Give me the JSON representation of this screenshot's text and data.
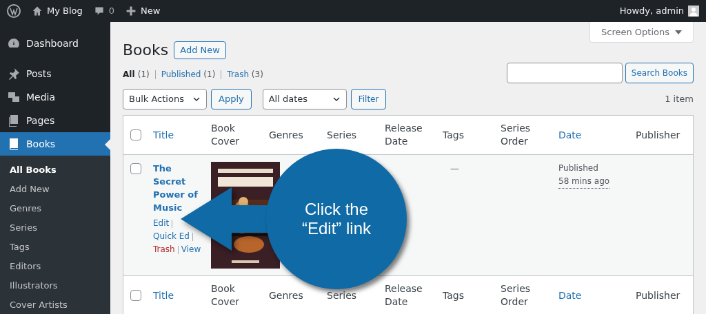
{
  "admin_bar": {
    "site": "My Blog",
    "comments": "0",
    "new": "New",
    "greeting": "Howdy, admin"
  },
  "sidebar": {
    "items": [
      {
        "label": "Dashboard",
        "selected": false
      },
      {
        "label": "Posts",
        "selected": false
      },
      {
        "label": "Media",
        "selected": false
      },
      {
        "label": "Pages",
        "selected": false
      },
      {
        "label": "Books",
        "selected": true,
        "children": [
          {
            "label": "All Books",
            "selected": true
          },
          {
            "label": "Add New",
            "selected": false
          },
          {
            "label": "Genres",
            "selected": false
          },
          {
            "label": "Series",
            "selected": false
          },
          {
            "label": "Tags",
            "selected": false
          },
          {
            "label": "Editors",
            "selected": false
          },
          {
            "label": "Illustrators",
            "selected": false
          },
          {
            "label": "Cover Artists",
            "selected": false
          }
        ]
      }
    ]
  },
  "screen_options": "Screen Options",
  "page_title": "Books",
  "add_new": "Add New",
  "filters": [
    {
      "label": "All",
      "count": "(1)",
      "selected": true
    },
    {
      "label": "Published",
      "count": "(1)",
      "selected": false
    },
    {
      "label": "Trash",
      "count": "(3)",
      "selected": false
    }
  ],
  "search": {
    "button": "Search Books"
  },
  "bulk_actions": "Bulk Actions",
  "apply": "Apply",
  "dates": "All dates",
  "filter": "Filter",
  "item_count": "1 item",
  "table": {
    "header_checked": false,
    "footer_checked": false,
    "columns": [
      {
        "label": "Title",
        "sortable": true
      },
      {
        "label": "Book Cover",
        "sortable": false
      },
      {
        "label": "Genres",
        "sortable": false
      },
      {
        "label": "Series",
        "sortable": false
      },
      {
        "label": "Release Date",
        "sortable": false
      },
      {
        "label": "Tags",
        "sortable": false
      },
      {
        "label": "Series Order",
        "sortable": false
      },
      {
        "label": "Date",
        "sortable": true
      },
      {
        "label": "Publisher",
        "sortable": false
      }
    ],
    "rows": [
      {
        "checked": false,
        "title": "The Secret Power of Music",
        "actions": [
          {
            "label": "Edit",
            "kind": "normal"
          },
          {
            "label": "Quick Ed",
            "kind": "normal"
          },
          {
            "label": "Trash",
            "kind": "danger"
          },
          {
            "label": "View",
            "kind": "normal"
          }
        ],
        "cover": {
          "kind": "picture"
        },
        "tags": "—",
        "status": "Published",
        "time": "58 mins ago"
      }
    ],
    "footer_columns": [
      {
        "label": "Title",
        "sortable": true
      },
      {
        "label": "Book Cover",
        "sortable": false
      },
      {
        "label": "Genres",
        "sortable": false
      },
      {
        "label": "Series",
        "sortable": false
      },
      {
        "label": "Release Date",
        "sortable": false
      },
      {
        "label": "Tags",
        "sortable": false
      },
      {
        "label": "Series Order",
        "sortable": false
      },
      {
        "label": "Date",
        "sortable": true
      },
      {
        "label": "Publisher",
        "sortable": false
      }
    ]
  },
  "callout": {
    "text": "Click the “Edit” link"
  }
}
